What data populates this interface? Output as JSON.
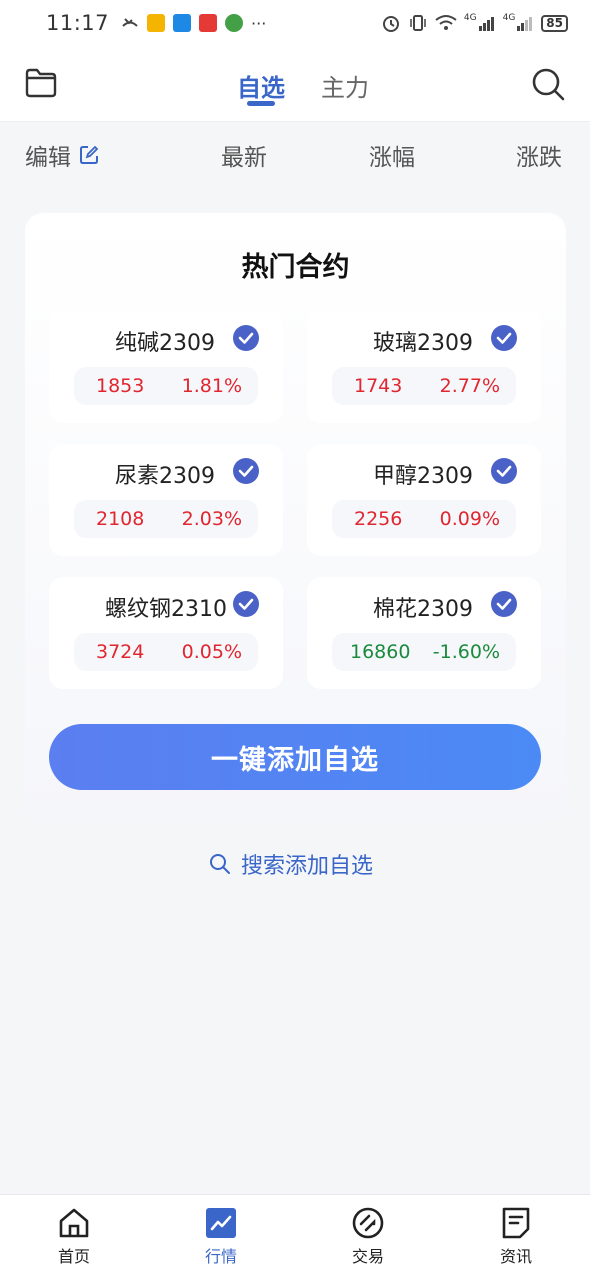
{
  "status_bar": {
    "time": "11:17",
    "dots": "···",
    "net_4g_a": "4G",
    "net_4g_b": "4G",
    "battery": "85"
  },
  "header": {
    "tabs": [
      {
        "label": "自选",
        "active": true
      },
      {
        "label": "主力",
        "active": false
      }
    ]
  },
  "columns": {
    "edit": "编辑",
    "latest": "最新",
    "change_pct": "涨幅",
    "change": "涨跌"
  },
  "hot": {
    "title": "热门合约",
    "items": [
      {
        "name": "纯碱2309",
        "price": "1853",
        "pct": "1.81%",
        "dir": "up",
        "checked": true
      },
      {
        "name": "玻璃2309",
        "price": "1743",
        "pct": "2.77%",
        "dir": "up",
        "checked": true
      },
      {
        "name": "尿素2309",
        "price": "2108",
        "pct": "2.03%",
        "dir": "up",
        "checked": true
      },
      {
        "name": "甲醇2309",
        "price": "2256",
        "pct": "0.09%",
        "dir": "up",
        "checked": true
      },
      {
        "name": "螺纹钢2310",
        "price": "3724",
        "pct": "0.05%",
        "dir": "up",
        "checked": true
      },
      {
        "name": "棉花2309",
        "price": "16860",
        "pct": "-1.60%",
        "dir": "down",
        "checked": true
      }
    ],
    "add_button": "一键添加自选"
  },
  "search_add": "搜索添加自选",
  "bottom_nav": [
    {
      "label": "首页",
      "icon": "home-icon",
      "active": false
    },
    {
      "label": "行情",
      "icon": "market-chart-icon",
      "active": true
    },
    {
      "label": "交易",
      "icon": "trade-icon",
      "active": false
    },
    {
      "label": "资讯",
      "icon": "news-icon",
      "active": false
    }
  ],
  "colors": {
    "accent": "#3a66c9",
    "up": "#e0262f",
    "down": "#1a8a3c",
    "button_gradient_start": "#5b7ef0",
    "button_gradient_end": "#4b8af5"
  }
}
